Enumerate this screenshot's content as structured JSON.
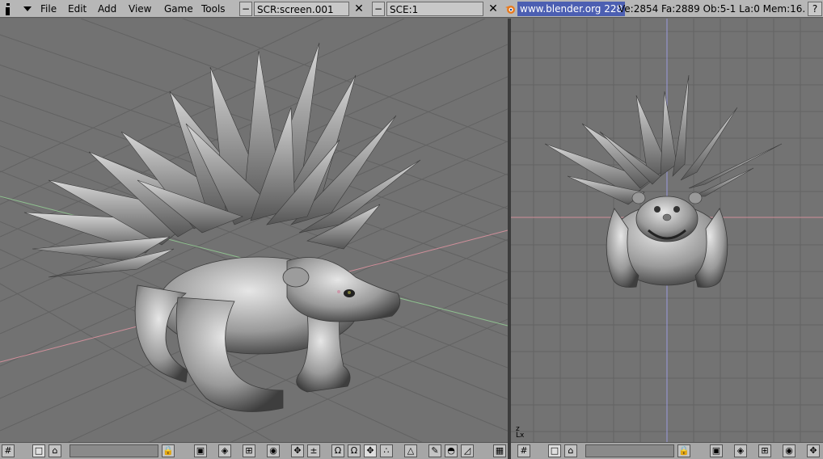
{
  "topbar": {
    "menus": [
      "File",
      "Edit",
      "Add",
      "View",
      "Game",
      "Tools"
    ],
    "screen_field": "SCR:screen.001",
    "scene_field": "SCE:1",
    "url": "www.blender.org 228",
    "stats": "Ve:2854 Fa:2889  Ob:5-1 La:0  Mem:16.",
    "help_label": "?"
  },
  "viewports": {
    "right_axis_label": "z\nLx"
  },
  "colors": {
    "bg_grid": "#727272",
    "x_axis": "#d08f9a",
    "y_axis": "#8fc08f",
    "z_axis": "#9a9adc",
    "url_bg": "#4c5fb2"
  },
  "icons": [
    "info-icon",
    "menu-collapse-icon",
    "blender-logo-icon",
    "lock-icon",
    "hand-icon",
    "magnet-icon",
    "render-icon"
  ]
}
